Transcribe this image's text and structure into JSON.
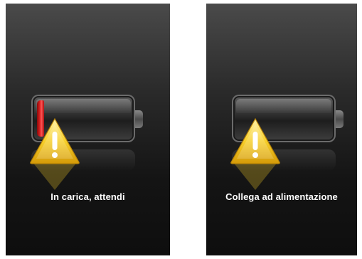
{
  "screens": [
    {
      "id": "charging",
      "message": "In carica, attendi",
      "battery_level": 0.06,
      "charge_color": "#e22424",
      "icon": "warning-icon"
    },
    {
      "id": "connect",
      "message": "Collega ad alimentazione",
      "battery_level": 0,
      "icon": "warning-icon"
    }
  ],
  "colors": {
    "background": "#141414",
    "warning_yellow": "#f5c518",
    "text": "#ffffff"
  }
}
